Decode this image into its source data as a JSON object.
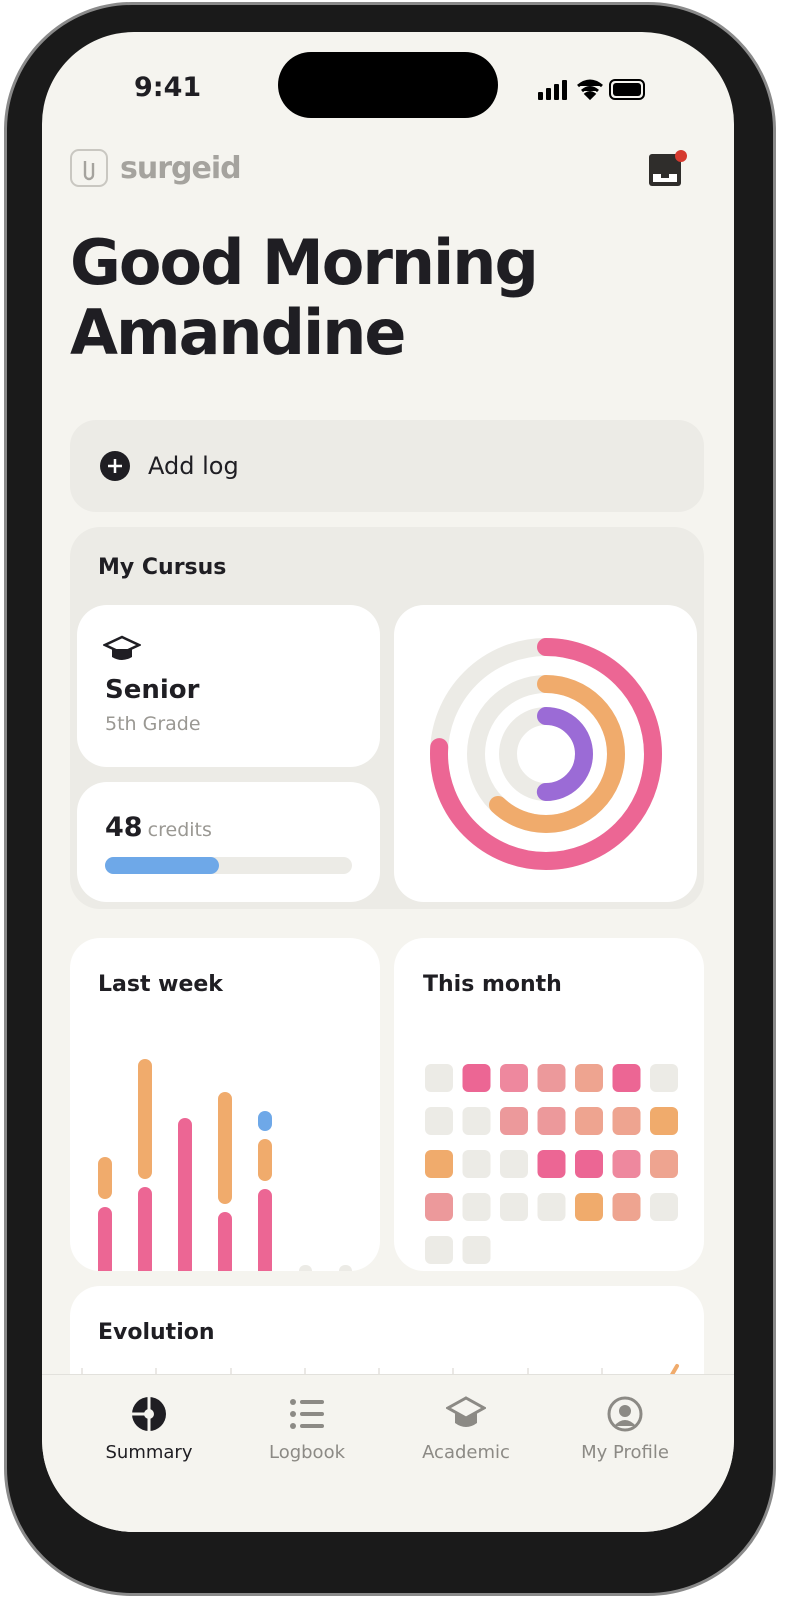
{
  "status": {
    "time": "9:41"
  },
  "brand": {
    "name": "surgeid"
  },
  "greeting": {
    "line1": "Good Morning",
    "line2": "Amandine"
  },
  "add_log": {
    "label": "Add log"
  },
  "cursus": {
    "title": "My Cursus",
    "level": "Senior",
    "grade": "5th Grade",
    "credits": "48",
    "credits_label": "credits",
    "credits_progress": 0.46,
    "rings": [
      {
        "color": "#ec6694",
        "progress": 0.76
      },
      {
        "color": "#f0ab6c",
        "progress": 0.62
      },
      {
        "color": "#9b6bd6",
        "progress": 0.5
      }
    ]
  },
  "last_week": {
    "title": "Last week",
    "chart_data": {
      "type": "bar",
      "stacked": true,
      "days": [
        [
          {
            "color": "#ec6694",
            "value": 77
          },
          {
            "color": "#f0ab6c",
            "value": 42
          }
        ],
        [
          {
            "color": "#ec6694",
            "value": 97
          },
          {
            "color": "#f0ab6c",
            "value": 120
          }
        ],
        [
          {
            "color": "#ec6694",
            "value": 166
          }
        ],
        [
          {
            "color": "#ec6694",
            "value": 72
          },
          {
            "color": "#f0ab6c",
            "value": 112
          }
        ],
        [
          {
            "color": "#ec6694",
            "value": 95
          },
          {
            "color": "#f0ab6c",
            "value": 42
          },
          {
            "color": "#6ea8e8",
            "value": 20
          }
        ],
        [],
        []
      ]
    }
  },
  "this_month": {
    "title": "This month",
    "chart_data": {
      "type": "heatmap",
      "cells": [
        "g",
        "h",
        "p",
        "r",
        "s",
        "h",
        "g",
        "g",
        "g",
        "r",
        "r",
        "s",
        "s",
        "o",
        "o",
        "g",
        "g",
        "h",
        "h",
        "p",
        "s",
        "r",
        "g",
        "g",
        "g",
        "o",
        "s",
        "g",
        "g",
        "g"
      ],
      "palette": {
        "g": "#ecebe6",
        "h": "#ec6694",
        "p": "#ee889e",
        "r": "#ec999b",
        "s": "#eea490",
        "o": "#f0ab6c"
      }
    }
  },
  "evolution": {
    "title": "Evolution"
  },
  "tabs": [
    {
      "label": "Summary",
      "icon": "summary-icon"
    },
    {
      "label": "Logbook",
      "icon": "list-icon"
    },
    {
      "label": "Academic",
      "icon": "graduation-cap-icon"
    },
    {
      "label": "My Profile",
      "icon": "profile-icon"
    }
  ]
}
